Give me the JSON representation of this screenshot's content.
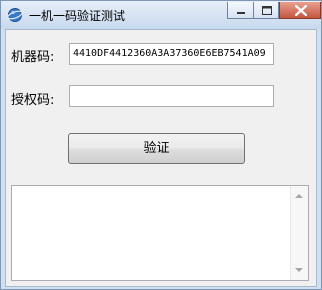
{
  "window": {
    "title": "一机一码验证测试",
    "minimize_icon": "minimize-icon",
    "maximize_icon": "maximize-icon",
    "close_icon": "close-icon",
    "app_icon": "app-icon"
  },
  "form": {
    "machine_code_label": "机器码:",
    "machine_code_value": "4410DF4412360A3A37360E6EB7541A09",
    "auth_code_label": "授权码:",
    "auth_code_value": "",
    "verify_button": "验证",
    "output_text": ""
  },
  "colors": {
    "titlebar": "#c8d9ee",
    "close_button": "#c4553e",
    "client_bg": "#f0f0f0"
  }
}
